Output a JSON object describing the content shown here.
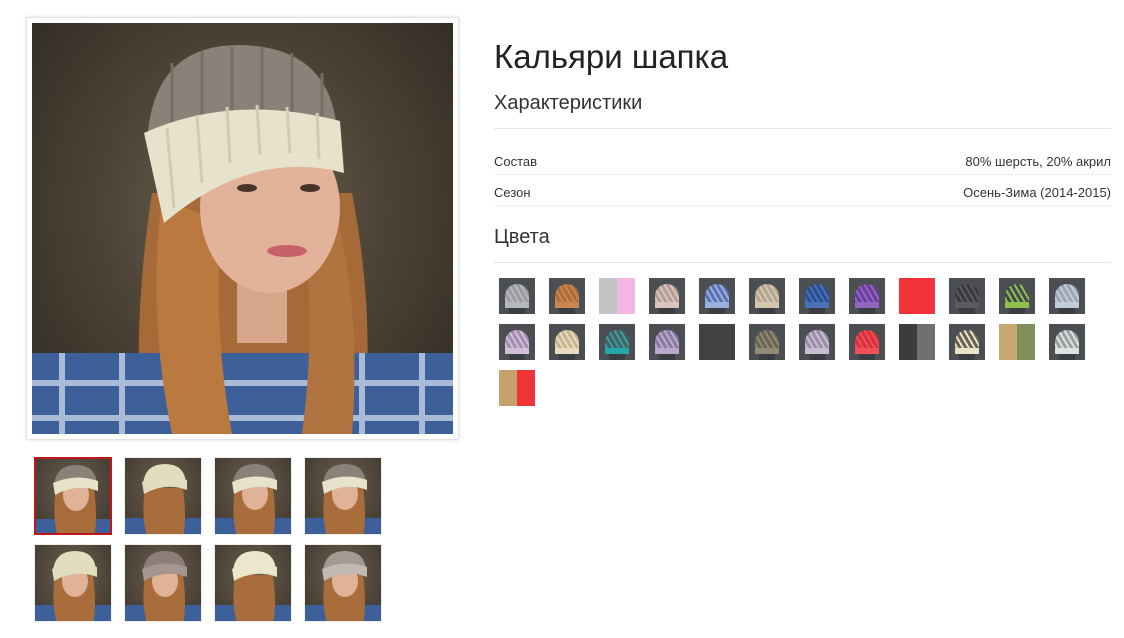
{
  "product": {
    "title": "Кальяри шапка",
    "characteristics_heading": "Характеристики",
    "specs": [
      {
        "label": "Состав",
        "value": "80% шерсть, 20% акрил"
      },
      {
        "label": "Сезон",
        "value": "Осень-Зима (2014-2015)"
      }
    ],
    "colors_heading": "Цвета"
  },
  "theme": {
    "active_border": "#c0171c",
    "rule": "#e5e5e5"
  },
  "swatches": [
    {
      "kind": "hat",
      "main": "#9a9aa0",
      "band": "#b7b8bd"
    },
    {
      "kind": "hat",
      "main": "#b06b3a",
      "band": "#c8884f"
    },
    {
      "kind": "split",
      "left": "#c3c3c5",
      "right": "#f4b6e2"
    },
    {
      "kind": "hat",
      "main": "#b59c95",
      "band": "#d8c5bf"
    },
    {
      "kind": "hat",
      "main": "#5a72b0",
      "band": "#9bb0dc"
    },
    {
      "kind": "hat",
      "main": "#b3a58f",
      "band": "#d5c7ae"
    },
    {
      "kind": "hat",
      "main": "#2b4f8e",
      "band": "#4a70b8"
    },
    {
      "kind": "hat",
      "main": "#6a3f9a",
      "band": "#9066c0"
    },
    {
      "kind": "solid",
      "color": "#f2343a"
    },
    {
      "kind": "hat",
      "main": "#3a3a3d",
      "band": "#5c5c60"
    },
    {
      "kind": "hat",
      "main": "#444a52",
      "band": "#8fbf4d"
    },
    {
      "kind": "hat",
      "main": "#9ba6b6",
      "band": "#c2ccd8"
    },
    {
      "kind": "hat",
      "main": "#a68bb0",
      "band": "#d2bfd8"
    },
    {
      "kind": "hat",
      "main": "#c8b48e",
      "band": "#e7dcc0"
    },
    {
      "kind": "hat",
      "main": "#555a60",
      "band": "#25a7a9"
    },
    {
      "kind": "hat",
      "main": "#8a7aa0",
      "band": "#b9a9cc"
    },
    {
      "kind": "solid",
      "color": "#404244"
    },
    {
      "kind": "hat",
      "main": "#6b6452",
      "band": "#918a74"
    },
    {
      "kind": "hat",
      "main": "#9a8ea6",
      "band": "#c7bfd1"
    },
    {
      "kind": "hat",
      "main": "#d6313c",
      "band": "#f05058"
    },
    {
      "kind": "split",
      "left": "#3a3c3e",
      "right": "#6e7072"
    },
    {
      "kind": "hat",
      "main": "#6c5f55",
      "band": "#e8e2c7"
    },
    {
      "kind": "split",
      "left": "#c8a872",
      "right": "#7f8e5d"
    },
    {
      "kind": "hat",
      "main": "#9aa0a0",
      "band": "#dfe3e0"
    },
    {
      "kind": "split",
      "left": "#c5a06a",
      "right": "#ee3438"
    }
  ],
  "thumbnails": [
    {
      "view": "front-left",
      "hat_main": "#8a8178",
      "hat_band": "#e7e2cc",
      "active": true
    },
    {
      "view": "back",
      "hat_main": "#e3dcbf",
      "hat_band": "#e3dcbf",
      "active": false
    },
    {
      "view": "front-left",
      "hat_main": "#8a8178",
      "hat_band": "#e7e2cc",
      "active": false
    },
    {
      "view": "side",
      "hat_main": "#8a8178",
      "hat_band": "#e7e2cc",
      "active": false
    },
    {
      "view": "side",
      "hat_main": "#e3dcbf",
      "hat_band": "#e3dcbf",
      "active": false
    },
    {
      "view": "front",
      "hat_main": "#8e7d78",
      "hat_band": "#a69690",
      "active": false
    },
    {
      "view": "back",
      "hat_main": "#ece6cc",
      "hat_band": "#ece6cc",
      "active": false
    },
    {
      "view": "side",
      "hat_main": "#a39a93",
      "hat_band": "#c1b9b2",
      "active": false
    }
  ]
}
